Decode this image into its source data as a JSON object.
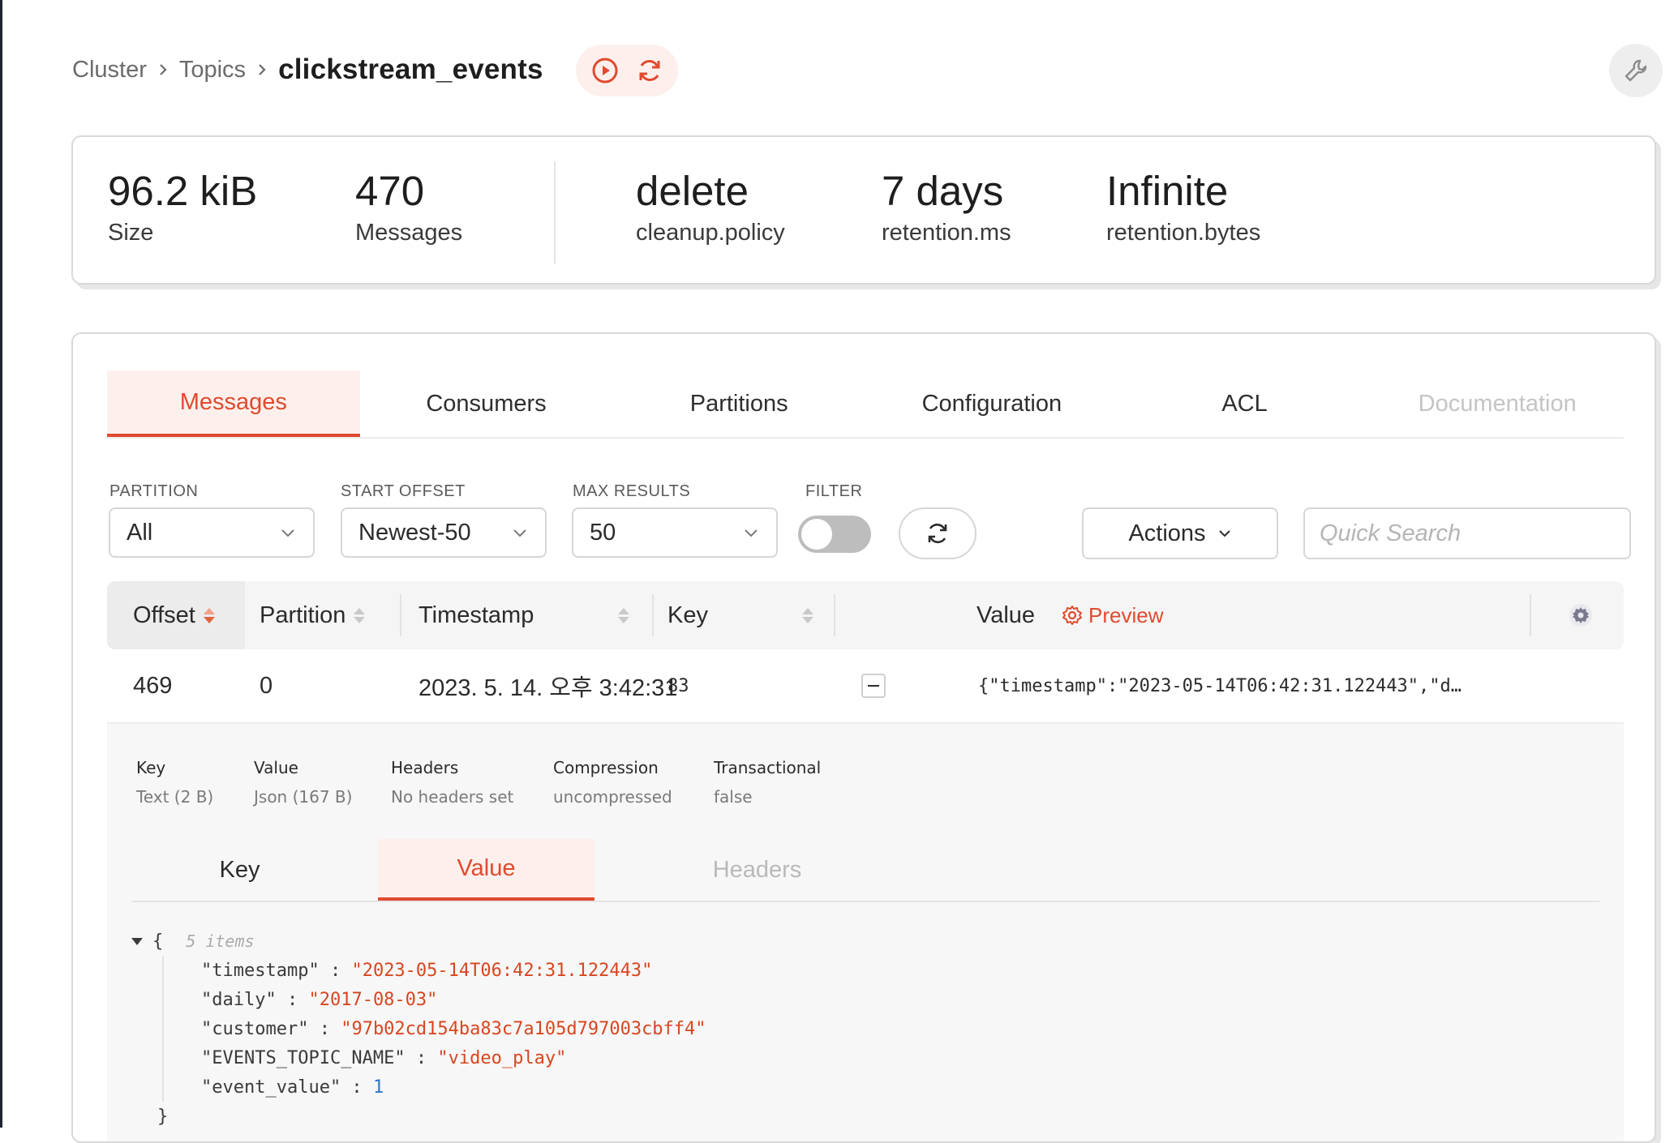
{
  "breadcrumb": {
    "cluster": "Cluster",
    "topics": "Topics",
    "current": "clickstream_events"
  },
  "stats": [
    {
      "value": "96.2 kiB",
      "label": "Size"
    },
    {
      "value": "470",
      "label": "Messages"
    },
    {
      "value": "delete",
      "label": "cleanup.policy"
    },
    {
      "value": "7 days",
      "label": "retention.ms"
    },
    {
      "value": "Infinite",
      "label": "retention.bytes"
    }
  ],
  "tabs": [
    {
      "label": "Messages",
      "state": "active"
    },
    {
      "label": "Consumers",
      "state": "normal"
    },
    {
      "label": "Partitions",
      "state": "normal"
    },
    {
      "label": "Configuration",
      "state": "normal"
    },
    {
      "label": "ACL",
      "state": "normal"
    },
    {
      "label": "Documentation",
      "state": "disabled"
    }
  ],
  "filters": {
    "partition": {
      "label": "PARTITION",
      "value": "All"
    },
    "start_offset": {
      "label": "START OFFSET",
      "value": "Newest-50"
    },
    "max_results": {
      "label": "MAX RESULTS",
      "value": "50"
    },
    "filter": {
      "label": "FILTER",
      "enabled": false
    },
    "actions_label": "Actions",
    "search_placeholder": "Quick Search"
  },
  "table": {
    "columns": {
      "offset": "Offset",
      "partition": "Partition",
      "timestamp": "Timestamp",
      "key": "Key",
      "value": "Value",
      "preview": "Preview"
    },
    "rows": [
      {
        "offset": "469",
        "partition": "0",
        "timestamp": "2023. 5. 14. 오후 3:42:31",
        "key": "83",
        "value": "{\"timestamp\":\"2023-05-14T06:42:31.122443\",\"d…"
      }
    ]
  },
  "detail": {
    "meta": [
      {
        "key": "Key",
        "value": "Text (2 B)"
      },
      {
        "key": "Value",
        "value": "Json (167 B)"
      },
      {
        "key": "Headers",
        "value": "No headers set"
      },
      {
        "key": "Compression",
        "value": "uncompressed"
      },
      {
        "key": "Transactional",
        "value": "false"
      }
    ],
    "tabs": [
      {
        "label": "Key",
        "state": "normal"
      },
      {
        "label": "Value",
        "state": "active"
      },
      {
        "label": "Headers",
        "state": "disabled"
      }
    ],
    "json": {
      "open": "{",
      "count": "5 items",
      "close": "}",
      "entries": [
        {
          "key": "\"timestamp\"",
          "value": "\"2023-05-14T06:42:31.122443\"",
          "kind": "string"
        },
        {
          "key": "\"daily\"",
          "value": "\"2017-08-03\"",
          "kind": "string"
        },
        {
          "key": "\"customer\"",
          "value": "\"97b02cd154ba83c7a105d797003cbff4\"",
          "kind": "string"
        },
        {
          "key": "\"EVENTS_TOPIC_NAME\"",
          "value": "\"video_play\"",
          "kind": "string"
        },
        {
          "key": "\"event_value\"",
          "value": "1",
          "kind": "number"
        }
      ]
    }
  },
  "colors": {
    "accent": "#e04a2f",
    "accent_bg": "#fdf0ec",
    "json_string": "#d8461f",
    "json_number": "#2b77c9"
  },
  "icons": {
    "play": "play-circle-icon",
    "refresh": "refresh-icon",
    "wrench": "wrench-icon",
    "settings": "gear-icon",
    "chevron": "chevron-down-icon"
  }
}
